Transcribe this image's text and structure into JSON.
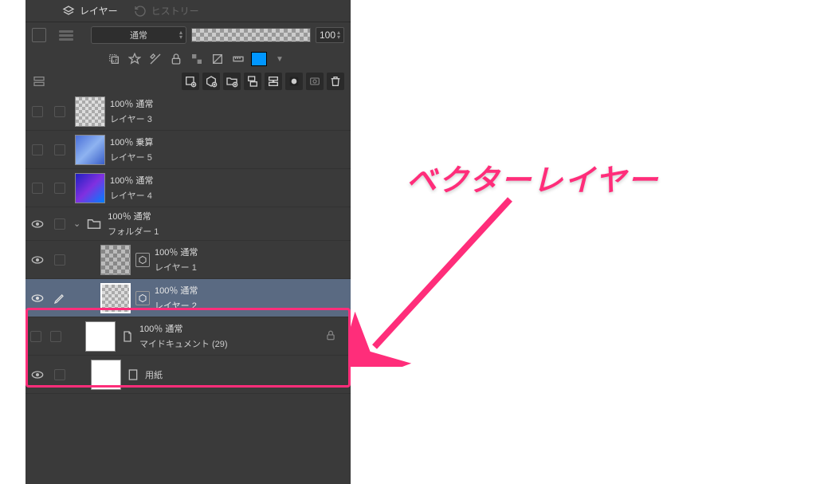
{
  "tabs": {
    "layers": "レイヤー",
    "history": "ヒストリー"
  },
  "blend_mode": "通常",
  "opacity_value": "100",
  "layers": [
    {
      "meta": "100％ 通常",
      "name": "レイヤー 3"
    },
    {
      "meta": "100％ 乗算",
      "name": "レイヤー 5"
    },
    {
      "meta": "100％ 通常",
      "name": "レイヤー 4"
    },
    {
      "meta": "100％ 通常",
      "name": "フォルダー 1"
    },
    {
      "meta": "100％ 通常",
      "name": "レイヤー 1"
    },
    {
      "meta": "100％ 通常",
      "name": "レイヤー 2"
    },
    {
      "meta": "100％ 通常",
      "name": "マイドキュメント (29)"
    },
    {
      "meta": "",
      "name": "用紙"
    }
  ],
  "annotation_text": "ベクターレイヤー"
}
